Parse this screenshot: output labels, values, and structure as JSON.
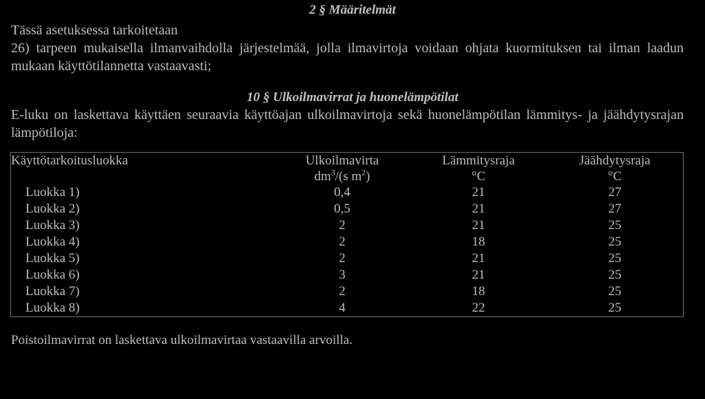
{
  "document": {
    "section_1": {
      "heading": "2 § Määritelmät",
      "lead": "Tässä asetuksessa tarkoitetaan",
      "item_26": "26) tarpeen mukaisella ilmanvaihdolla järjestelmää, jolla ilmavirtoja voidaan ohjata kuormituksen tai ilman laadun mukaan käyttötilannetta vastaavasti;"
    },
    "section_2": {
      "heading": "10 § Ulkoilmavirrat ja huonelämpötilat",
      "intro": "E-luku on laskettava käyttäen seuraavia käyttöajan ulkoilmavirtoja sekä huonelämpötilan lämmitys- ja jäähdytysrajan lämpötiloja:"
    },
    "table": {
      "headers": {
        "class": "Käyttötarkoitusluokka",
        "airflow": "Ulkoilmavirta",
        "airflow_unit_prefix": "dm",
        "airflow_unit_sup1": "3",
        "airflow_unit_mid": "/(s m",
        "airflow_unit_sup2": "2",
        "airflow_unit_suffix": ")",
        "heating": "Lämmitysraja",
        "heating_unit": "°C",
        "cooling": "Jäähdytysraja",
        "cooling_unit": "°C"
      },
      "rows": [
        {
          "class": "Luokka 1)",
          "airflow": "0,4",
          "heating": "21",
          "cooling": "27"
        },
        {
          "class": "Luokka 2)",
          "airflow": "0,5",
          "heating": "21",
          "cooling": "27"
        },
        {
          "class": "Luokka 3)",
          "airflow": "2",
          "heating": "21",
          "cooling": "25"
        },
        {
          "class": "Luokka 4)",
          "airflow": "2",
          "heating": "18",
          "cooling": "25"
        },
        {
          "class": "Luokka 5)",
          "airflow": "2",
          "heating": "21",
          "cooling": "25"
        },
        {
          "class": "Luokka 6)",
          "airflow": "3",
          "heating": "21",
          "cooling": "25"
        },
        {
          "class": "Luokka 7)",
          "airflow": "2",
          "heating": "18",
          "cooling": "25"
        },
        {
          "class": "Luokka 8)",
          "airflow": "4",
          "heating": "22",
          "cooling": "25"
        }
      ]
    },
    "footer_note": "Poistoilmavirrat on laskettava ulkoilmavirtaa vastaavilla arvoilla."
  },
  "colors": {
    "background": "#000000",
    "text": "#bdbdbd",
    "rule": "#6e6e6e"
  }
}
